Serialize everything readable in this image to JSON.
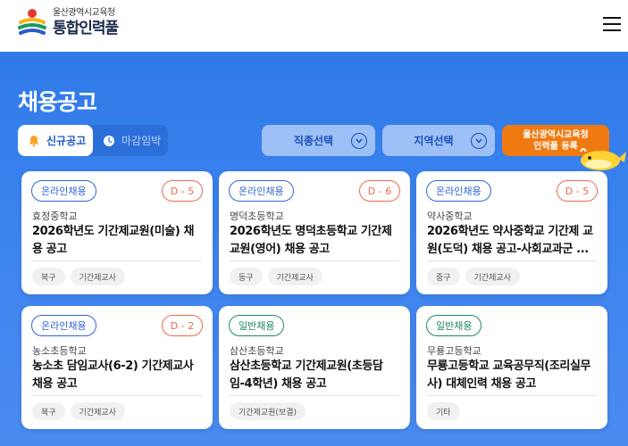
{
  "header": {
    "logo_sub": "울산광역시교육청",
    "logo_main": "통합인력풀",
    "menu_icon": "hamburger-menu-icon"
  },
  "page": {
    "title": "채용공고"
  },
  "tabs": [
    {
      "label": "신규공고",
      "icon": "bell-icon",
      "active": true
    },
    {
      "label": "마감임박",
      "icon": "clock-icon",
      "active": false
    }
  ],
  "filters": {
    "job": {
      "label": "직종선택"
    },
    "region": {
      "label": "지역선택"
    }
  },
  "register": {
    "line1": "울산광역시교육청",
    "line2": "인력풀 등록"
  },
  "colors": {
    "primary_blue": "#3b82ef",
    "orange": "#f07a12",
    "online_badge": "#2f65d6",
    "general_badge": "#1e8a5a",
    "dday": "#ee6a4c"
  },
  "postings": [
    {
      "type": "온라인채용",
      "kind": "online",
      "dday": "D - 5",
      "school": "효정중학교",
      "title": "2026학년도 기간제교원(미술) 채용 공고",
      "tags": [
        "북구",
        "기간제교사"
      ]
    },
    {
      "type": "온라인채용",
      "kind": "online",
      "dday": "D - 6",
      "school": "명덕초등학교",
      "title": "2026학년도 명덕초등학교 기간제교원(영어) 채용 공고",
      "tags": [
        "동구",
        "기간제교사"
      ]
    },
    {
      "type": "온라인채용",
      "kind": "online",
      "dday": "D - 5",
      "school": "약사중학교",
      "title": "2026학년도 약사중학교 기간제 교원(도덕) 채용 공고-사회교과군 ...",
      "tags": [
        "중구",
        "기간제교사"
      ]
    },
    {
      "type": "온라인채용",
      "kind": "online",
      "dday": "D - 2",
      "school": "농소초등학교",
      "title": "농소초 담임교사(6-2) 기간제교사 채용 공고",
      "tags": [
        "북구",
        "기간제교사"
      ]
    },
    {
      "type": "일반채용",
      "kind": "general",
      "dday": "",
      "school": "삼산초등학교",
      "title": "삼산초등학교 기간제교원(초등담임-4학년) 채용 공고",
      "tags": [
        "기간제교원(보결)"
      ]
    },
    {
      "type": "일반채용",
      "kind": "general",
      "dday": "",
      "school": "무룡고등학교",
      "title": "무룡고등학교 교육공무직(조리실무사) 대체인력 채용 공고",
      "tags": [
        "기타"
      ]
    }
  ]
}
